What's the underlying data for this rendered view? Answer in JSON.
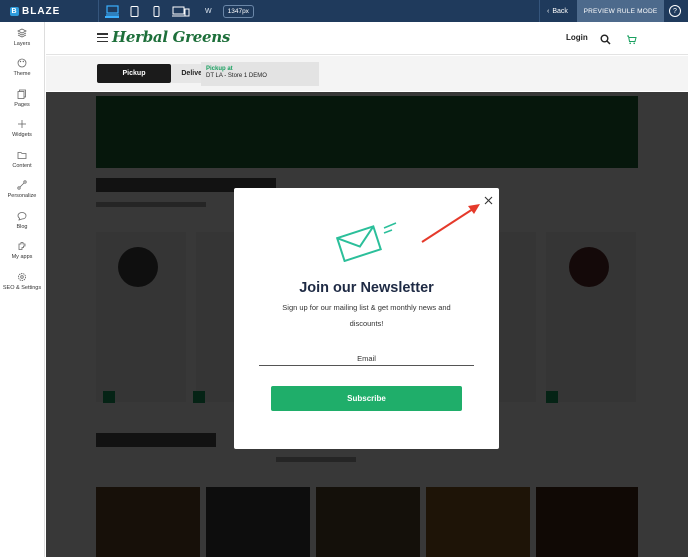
{
  "topbar": {
    "logo_text": "BLAZE",
    "logo_mark": "B",
    "width_label": "W",
    "width_value": "1347px",
    "back_label": "Back",
    "preview_label": "PREVIEW RULE MODE",
    "help_label": "?",
    "devices": [
      "desktop-icon",
      "tablet-icon",
      "mobile-icon",
      "devices-icon"
    ]
  },
  "sidebar": {
    "items": [
      {
        "label": "Layers",
        "icon": "layers-icon"
      },
      {
        "label": "Theme",
        "icon": "palette-icon"
      },
      {
        "label": "Pages",
        "icon": "pages-icon"
      },
      {
        "label": "Widgets",
        "icon": "plus-icon"
      },
      {
        "label": "Content",
        "icon": "folder-icon"
      },
      {
        "label": "Personalize",
        "icon": "personalize-icon"
      },
      {
        "label": "Blog",
        "icon": "chat-icon"
      },
      {
        "label": "My apps",
        "icon": "apps-icon"
      },
      {
        "label": "SEO & Settings",
        "icon": "gear-icon"
      }
    ]
  },
  "site": {
    "brand": "Herbal Greens",
    "login": "Login",
    "tab_pickup": "Pickup",
    "tab_delivery": "Delivery",
    "pickup_at": "Pickup at",
    "store": "DT LA - Store 1 DEMO"
  },
  "modal": {
    "title": "Join our Newsletter",
    "description": "Sign up for our mailing list & get monthly news and discounts!",
    "email_placeholder": "Email",
    "subscribe_label": "Subscribe"
  },
  "colors": {
    "topbar": "#1f3a5c",
    "accent_green": "#1fae6a",
    "brand_green": "#1d6f3a",
    "annotation_arrow": "#e53a2b"
  }
}
